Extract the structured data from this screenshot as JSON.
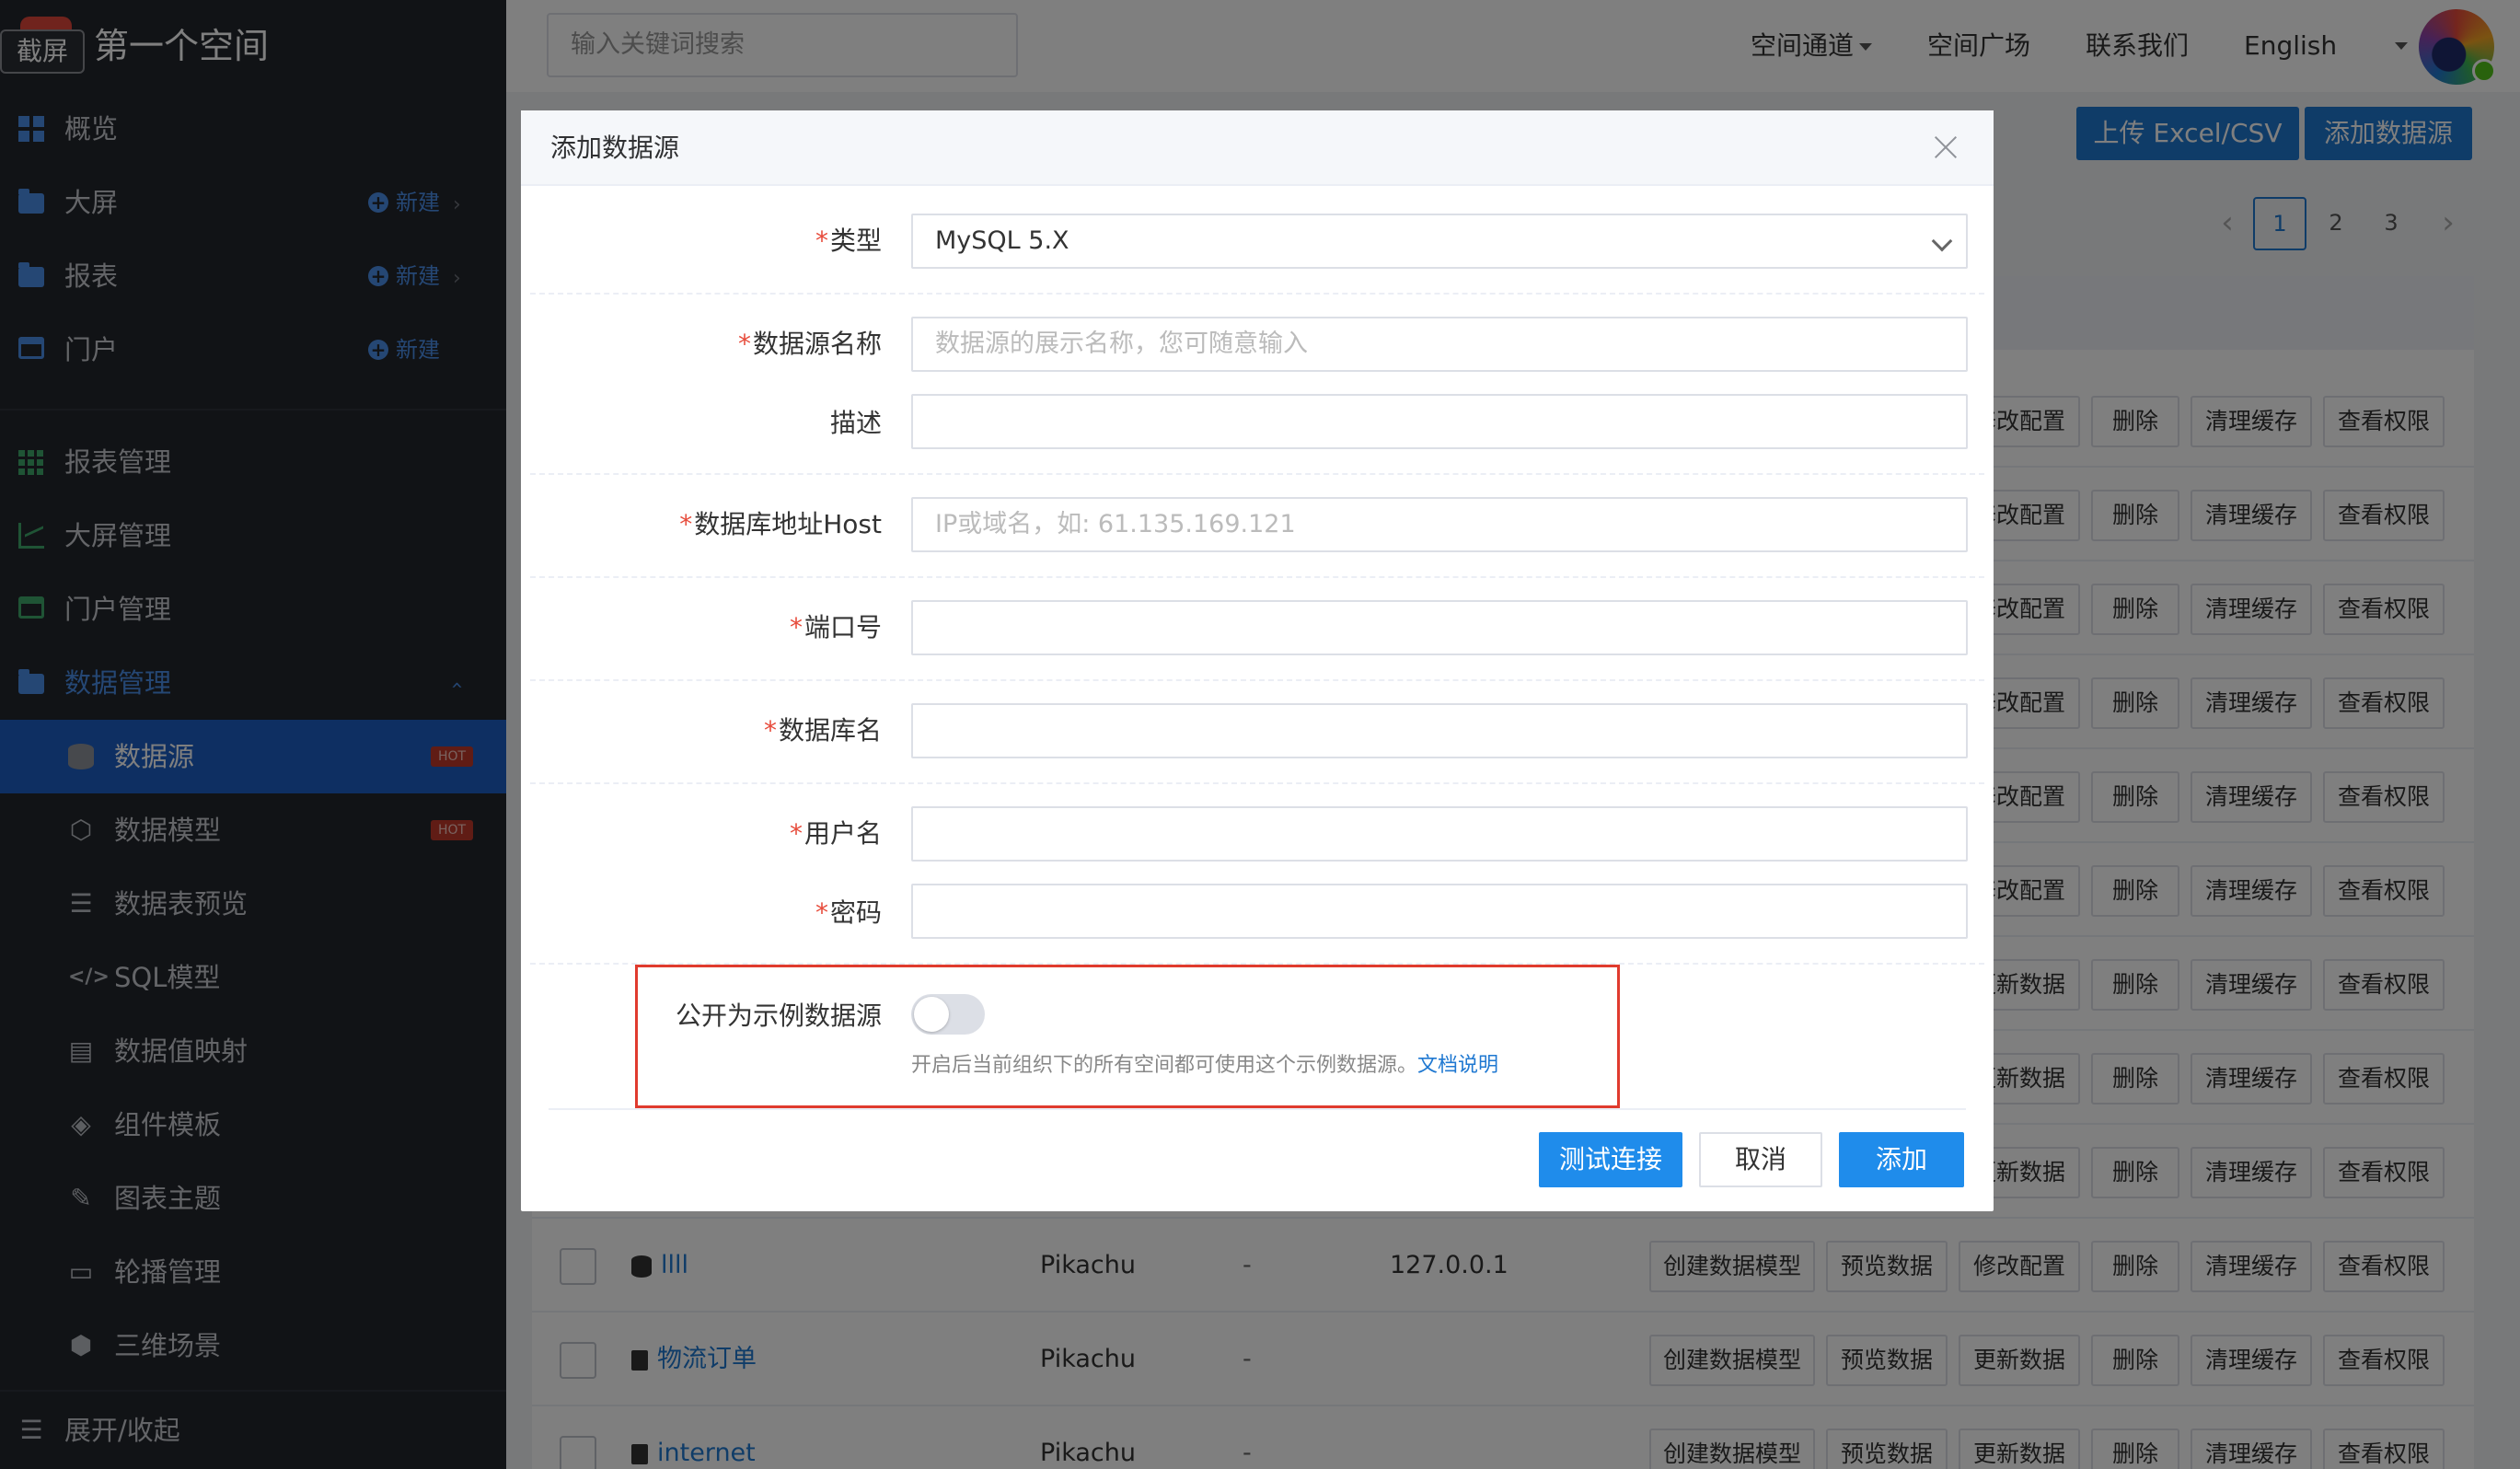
{
  "brand": {
    "tag": "截屏",
    "title": "第一个空间"
  },
  "sidebar": {
    "items": [
      {
        "label": "概览"
      },
      {
        "label": "大屏",
        "new": "新建"
      },
      {
        "label": "报表",
        "new": "新建"
      },
      {
        "label": "门户",
        "new": "新建"
      },
      {
        "label": "报表管理"
      },
      {
        "label": "大屏管理"
      },
      {
        "label": "门户管理"
      },
      {
        "label": "数据管理"
      },
      {
        "label": "数据源",
        "badge": "HOT"
      },
      {
        "label": "数据模型",
        "badge": "HOT"
      },
      {
        "label": "数据表预览"
      },
      {
        "label": "SQL模型"
      },
      {
        "label": "数据值映射"
      },
      {
        "label": "组件模板"
      },
      {
        "label": "图表主题"
      },
      {
        "label": "轮播管理"
      },
      {
        "label": "三维场景"
      }
    ],
    "footer": "展开/收起"
  },
  "topbar": {
    "search_placeholder": "输入关键词搜索",
    "nav": [
      "空间通道",
      "空间广场",
      "联系我们",
      "English"
    ]
  },
  "toolbar": {
    "upload": "上传 Excel/CSV",
    "add": "添加数据源"
  },
  "pagination": {
    "pages": [
      "1",
      "2",
      "3"
    ],
    "current": "1"
  },
  "table": {
    "actions_top": [
      "修改配置",
      "删除",
      "清理缓存",
      "查看权限"
    ],
    "actions_alt": [
      "更新数据",
      "删除",
      "清理缓存",
      "查看权限"
    ],
    "rows": [
      {
        "name": "llll",
        "owner": "Pikachu",
        "desc": "-",
        "host": "127.0.0.1",
        "actions": [
          "创建数据模型",
          "预览数据",
          "修改配置",
          "删除",
          "清理缓存",
          "查看权限"
        ]
      },
      {
        "name": "物流订单",
        "owner": "Pikachu",
        "desc": "-",
        "host": "",
        "actions": [
          "创建数据模型",
          "预览数据",
          "更新数据",
          "删除",
          "清理缓存",
          "查看权限"
        ]
      },
      {
        "name": "internet",
        "owner": "Pikachu",
        "desc": "-",
        "host": "",
        "actions": [
          "创建数据模型",
          "预览数据",
          "更新数据",
          "删除",
          "清理缓存",
          "查看权限"
        ]
      }
    ]
  },
  "modal": {
    "title": "添加数据源",
    "fields": {
      "type": {
        "label": "类型",
        "value": "MySQL 5.X",
        "required": true
      },
      "name": {
        "label": "数据源名称",
        "placeholder": "数据源的展示名称，您可随意输入",
        "required": true
      },
      "desc": {
        "label": "描述",
        "placeholder": "",
        "required": false
      },
      "host": {
        "label": "数据库地址Host",
        "placeholder": "IP或域名，如: 61.135.169.121",
        "required": true
      },
      "port": {
        "label": "端口号",
        "placeholder": "",
        "required": true
      },
      "db": {
        "label": "数据库名",
        "placeholder": "",
        "required": true
      },
      "user": {
        "label": "用户名",
        "placeholder": "",
        "required": true
      },
      "password": {
        "label": "密码",
        "placeholder": "",
        "required": true
      }
    },
    "public_toggle": {
      "label": "公开为示例数据源",
      "enabled": false,
      "hint": "开启后当前组织下的所有空间都可使用这个示例数据源。",
      "doc_link": "文档说明"
    },
    "buttons": {
      "test": "测试连接",
      "cancel": "取消",
      "add": "添加"
    }
  },
  "colors": {
    "primary": "#1f8ceb",
    "sidebar_bg": "#23262d",
    "selected_bg": "#1d5fc4",
    "highlight_box": "#e03b2e",
    "required": "#e74c3c"
  }
}
